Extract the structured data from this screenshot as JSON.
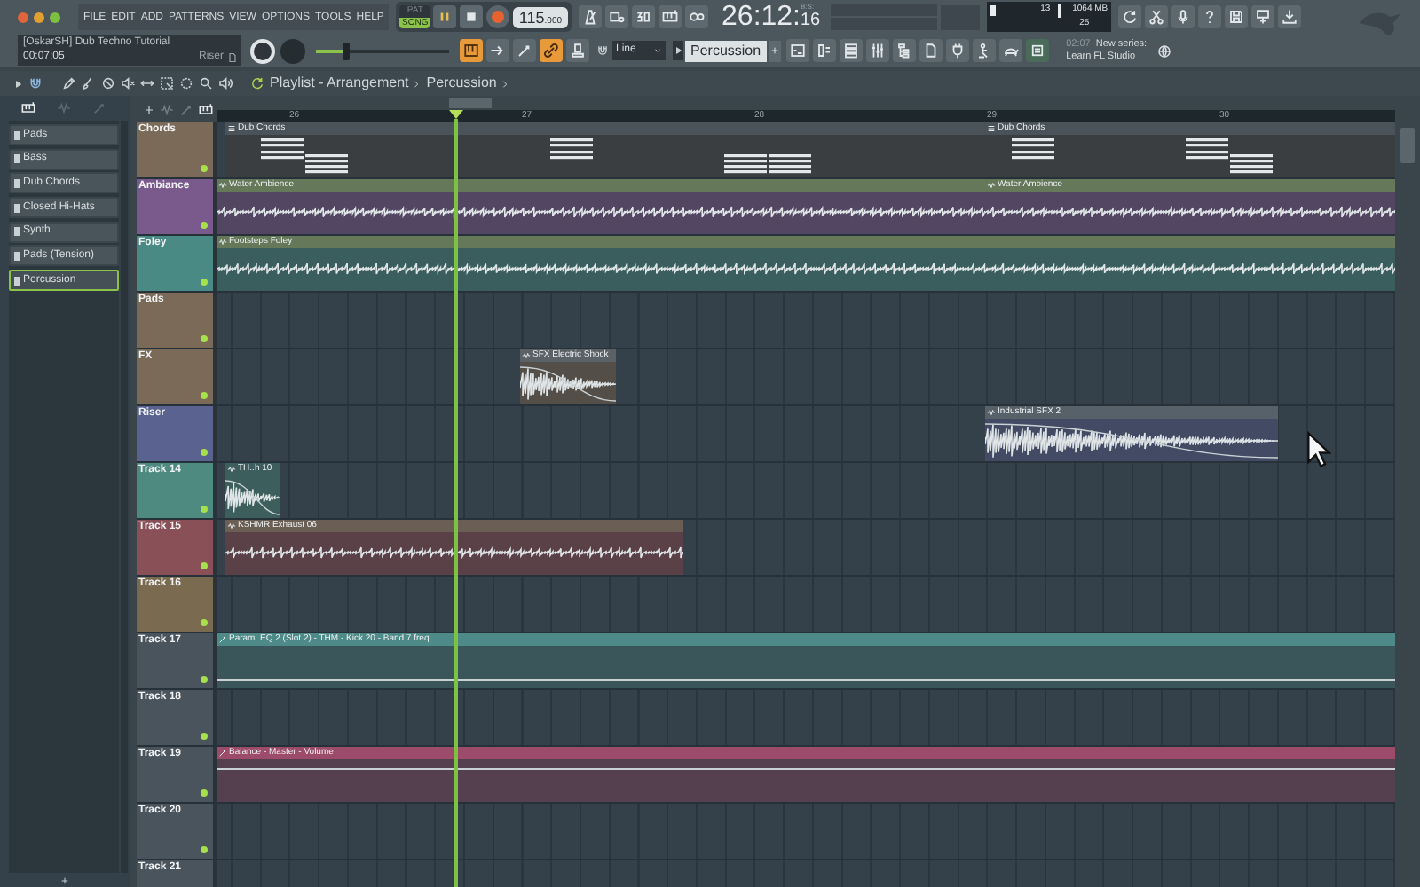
{
  "menu": [
    "FILE",
    "EDIT",
    "ADD",
    "PATTERNS",
    "VIEW",
    "OPTIONS",
    "TOOLS",
    "HELP"
  ],
  "transport": {
    "modes": [
      {
        "label": "PAT",
        "selected": false
      },
      {
        "label": "SONG",
        "selected": true
      }
    ],
    "playing": true
  },
  "tempo": {
    "whole": "115",
    "fraction": ".000"
  },
  "time": {
    "main": "26:12:",
    "ticks": "16",
    "format": "B:S:T"
  },
  "monitor": {
    "cpu": "13",
    "memory": "1064 MB",
    "polyphony": "25"
  },
  "project": {
    "title": "[OskarSH] Dub Techno Tutorial",
    "time": "00:07:05",
    "hint": "Riser"
  },
  "master_pitch": {
    "level": 0.22
  },
  "snap_tools": [
    {
      "on": true
    },
    {
      "on": false
    },
    {
      "on": false
    },
    {
      "on": true
    },
    {
      "on": false
    }
  ],
  "snap": "Line",
  "pattern": "Percussion",
  "news": {
    "time": "02:07",
    "title": "New series:",
    "subtitle": "Learn FL Studio"
  },
  "playlist": {
    "path": [
      "Playlist - Arrangement",
      "Percussion"
    ],
    "bars": [
      "26",
      "27",
      "28",
      "29",
      "30"
    ]
  },
  "channels": [
    {
      "name": "Pads",
      "selected": false
    },
    {
      "name": "Bass",
      "selected": false
    },
    {
      "name": "Dub Chords",
      "selected": false
    },
    {
      "name": "Closed Hi-Hats",
      "selected": false
    },
    {
      "name": "Synth",
      "selected": false
    },
    {
      "name": "Pads (Tension)",
      "selected": false
    },
    {
      "name": "Percussion",
      "selected": true
    }
  ],
  "tracks": [
    {
      "name": "Chords",
      "color": "#7b6a57",
      "clips": [
        {
          "kind": "pattern",
          "label": "Dub Chords",
          "color": "#4a5359"
        },
        {
          "kind": "pattern",
          "label": "Dub Chords",
          "color": "#4a5359"
        }
      ]
    },
    {
      "name": "Ambiance",
      "color": "#7a5a8c",
      "clips": [
        {
          "kind": "audio",
          "label": "Water Ambience",
          "color": "#66785a"
        },
        {
          "kind": "audio",
          "label": "Water Ambience",
          "color": "#66785a"
        }
      ]
    },
    {
      "name": "Foley",
      "color": "#4a8a84",
      "clips": [
        {
          "kind": "audio",
          "label": "Footsteps Foley",
          "color": "#66785a"
        }
      ]
    },
    {
      "name": "Pads",
      "color": "#7b6a57"
    },
    {
      "name": "FX",
      "color": "#7b6a57",
      "clips": [
        {
          "kind": "audio",
          "label": "SFX Electric Shock",
          "color": "#5a6167"
        }
      ]
    },
    {
      "name": "Riser",
      "color": "#5a6290",
      "clips": [
        {
          "kind": "audio",
          "label": "Industrial SFX 2",
          "color": "#56616a"
        }
      ]
    },
    {
      "name": "Track 14",
      "color": "#4e8a80",
      "clips": [
        {
          "kind": "audio",
          "label": "TH..h 10",
          "color": "#3e5d5f"
        }
      ]
    },
    {
      "name": "Track 15",
      "color": "#8a5058",
      "clips": [
        {
          "kind": "audio",
          "label": "KSHMR Exhaust 06",
          "color": "#6b5f55"
        }
      ]
    },
    {
      "name": "Track 16",
      "color": "#7a6a50"
    },
    {
      "name": "Track 17",
      "color": "#4a545c",
      "clips": [
        {
          "kind": "automation",
          "label": "Param. EQ 2 (Slot 2) - THM - Kick 20 - Band 7 freq",
          "color": "#4e8a88"
        }
      ]
    },
    {
      "name": "Track 18",
      "color": "#4a545c"
    },
    {
      "name": "Track 19",
      "color": "#4a545c",
      "clips": [
        {
          "kind": "automation",
          "label": "Balance - Master - Volume",
          "color": "#9c4c6a"
        }
      ]
    },
    {
      "name": "Track 20",
      "color": "#4a545c"
    },
    {
      "name": "Track 21",
      "color": "#4a545c"
    }
  ]
}
